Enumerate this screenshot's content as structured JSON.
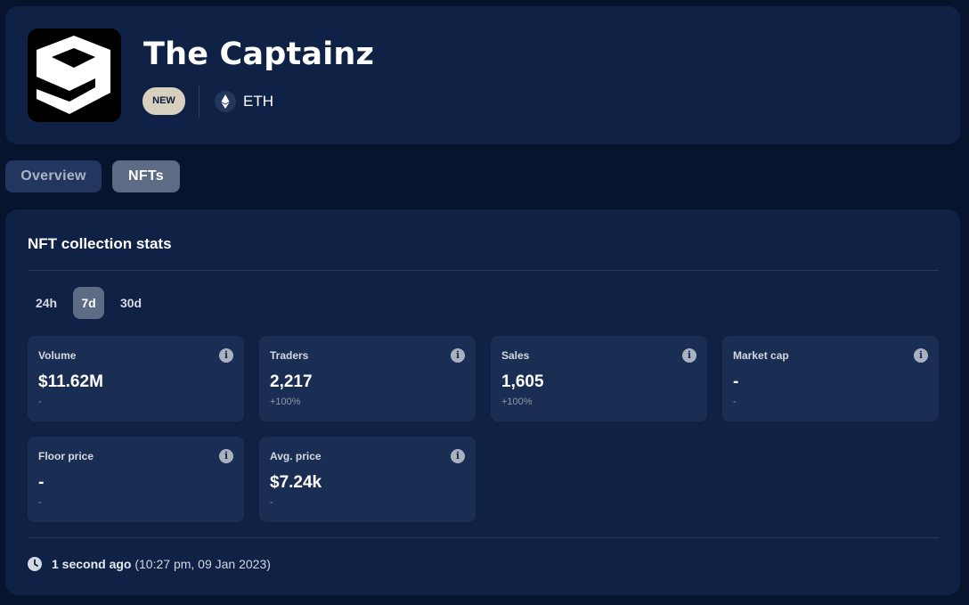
{
  "header": {
    "title": "The Captainz",
    "badge": "NEW",
    "chain": "ETH",
    "logo_icon": "nine-logo-icon",
    "chain_icon": "ethereum-icon"
  },
  "tabs": [
    {
      "label": "Overview",
      "active": false
    },
    {
      "label": "NFTs",
      "active": true
    }
  ],
  "stats": {
    "title": "NFT collection stats",
    "periods": [
      {
        "label": "24h",
        "active": false
      },
      {
        "label": "7d",
        "active": true
      },
      {
        "label": "30d",
        "active": false
      }
    ],
    "cards": [
      {
        "label": "Volume",
        "value": "$11.62M",
        "change": "-"
      },
      {
        "label": "Traders",
        "value": "2,217",
        "change": "+100%"
      },
      {
        "label": "Sales",
        "value": "1,605",
        "change": "+100%"
      },
      {
        "label": "Market cap",
        "value": "-",
        "change": "-"
      },
      {
        "label": "Floor price",
        "value": "-",
        "change": "-"
      },
      {
        "label": "Avg. price",
        "value": "$7.24k",
        "change": "-"
      }
    ],
    "info_icon_glyph": "i",
    "updated_relative": "1 second ago",
    "updated_absolute": "(10:27 pm, 09 Jan 2023)"
  },
  "colors": {
    "background": "#06142e",
    "card": "#0f2145",
    "stat_card": "#1a2d52",
    "active_pill": "#5d6b85",
    "badge": "#d8d0bf"
  }
}
